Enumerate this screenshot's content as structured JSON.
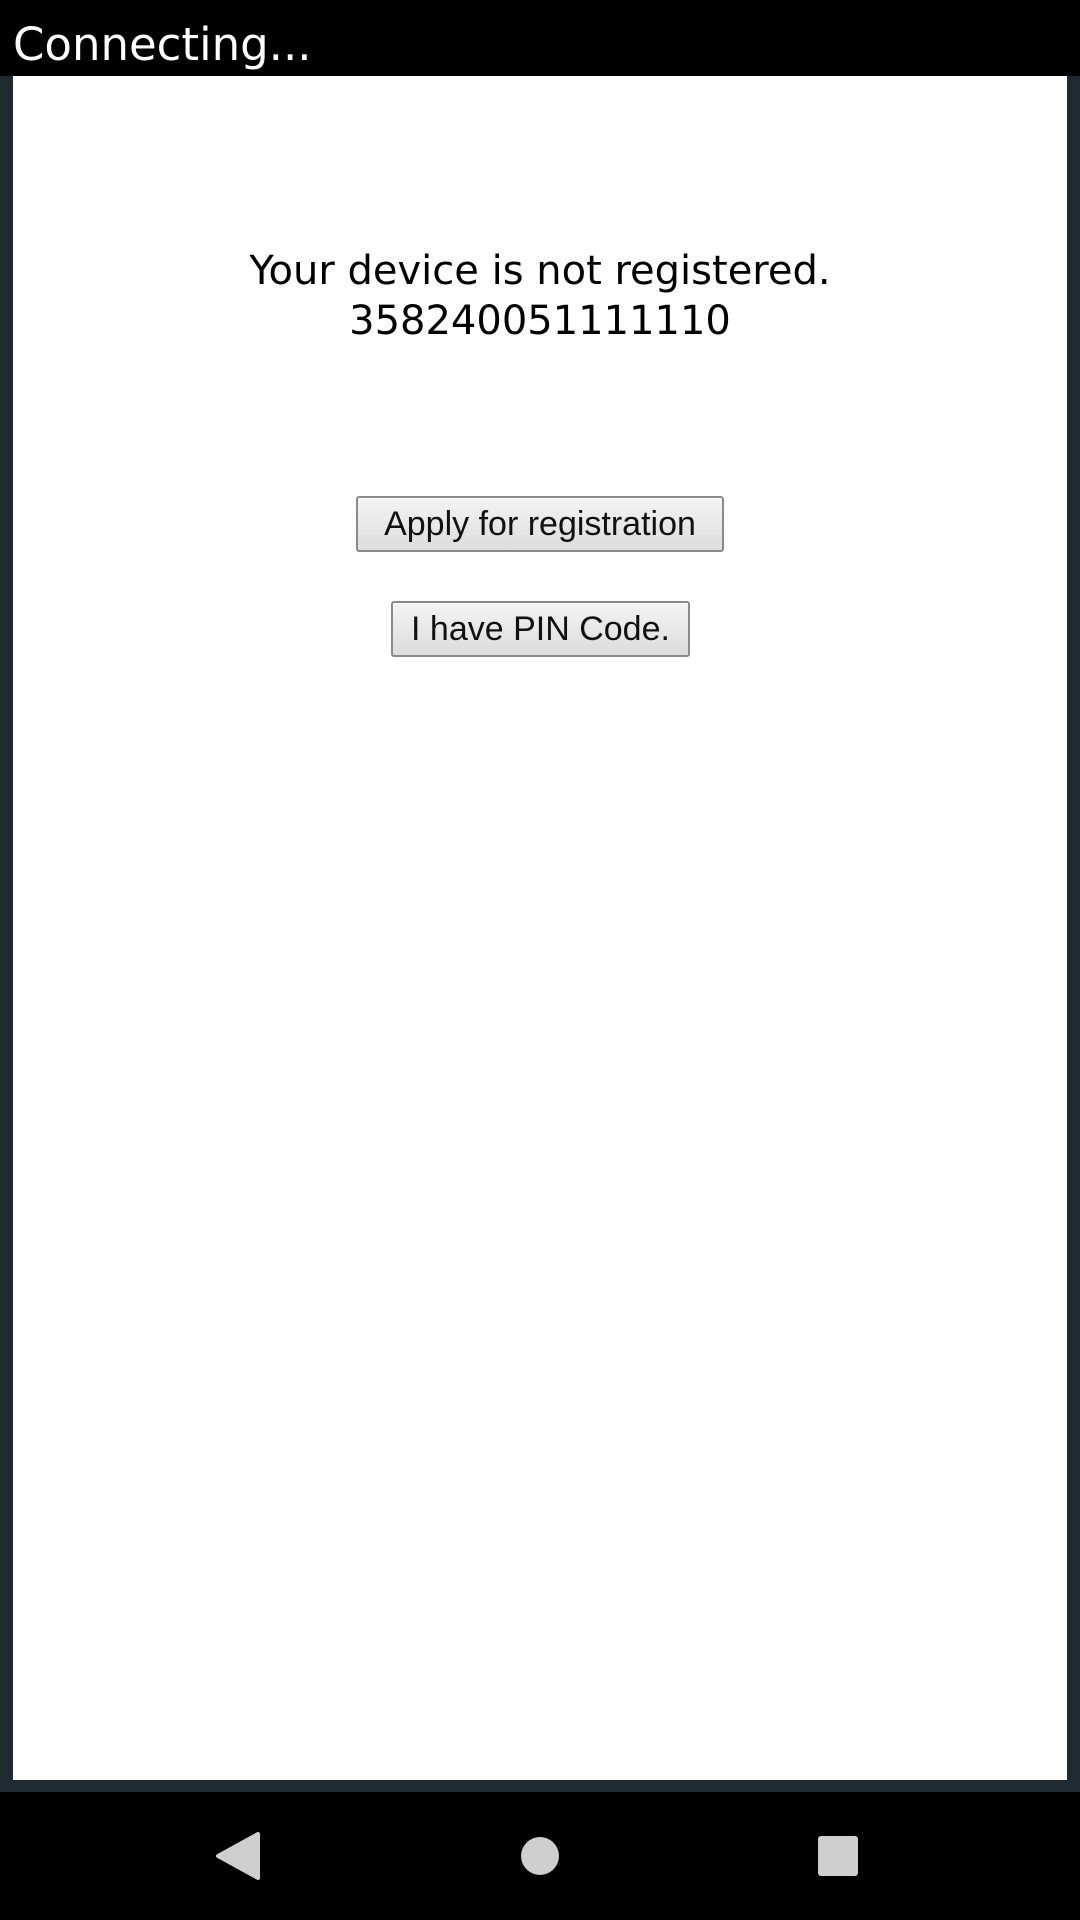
{
  "status_bar": {
    "title": "Connecting..."
  },
  "registration": {
    "message": "Your device is not registered.",
    "device_id": "358240051111110",
    "apply_button_label": "Apply for registration",
    "pin_button_label": "I have PIN Code."
  },
  "nav_bar": {
    "icons": [
      "back-icon",
      "home-icon",
      "recent-apps-icon"
    ]
  },
  "colors": {
    "background": "#202a31",
    "bars": "#000000",
    "content": "#ffffff",
    "nav_icons": "#cfcfcf"
  }
}
